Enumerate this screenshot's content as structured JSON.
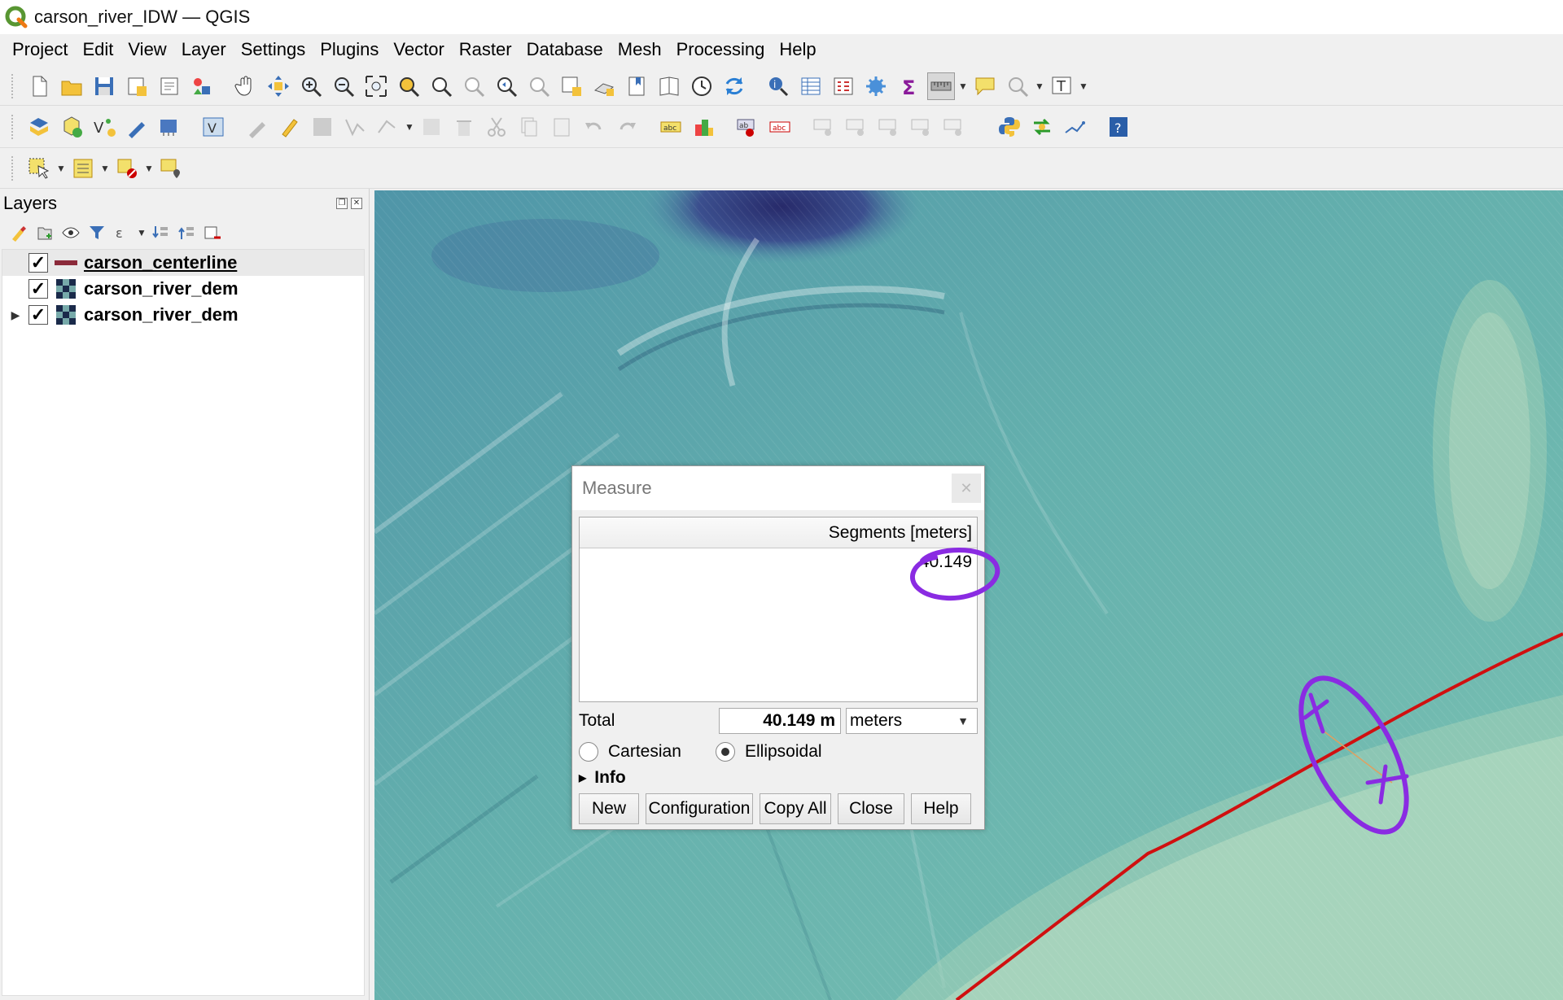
{
  "window": {
    "title": "carson_river_IDW — QGIS"
  },
  "menu": [
    "Project",
    "Edit",
    "View",
    "Layer",
    "Settings",
    "Plugins",
    "Vector",
    "Raster",
    "Database",
    "Mesh",
    "Processing",
    "Help"
  ],
  "layers_panel": {
    "title": "Layers",
    "layers": [
      {
        "name": "carson_centerline",
        "checked": true,
        "type": "line",
        "selected": true,
        "expandable": false
      },
      {
        "name": "carson_river_dem",
        "checked": true,
        "type": "raster",
        "selected": false,
        "expandable": false
      },
      {
        "name": "carson_river_dem",
        "checked": true,
        "type": "raster",
        "selected": false,
        "expandable": true
      }
    ]
  },
  "measure": {
    "title": "Measure",
    "segments_header": "Segments [meters]",
    "segments": [
      "40.149"
    ],
    "total_label": "Total",
    "total_value": "40.149 m",
    "unit": "meters",
    "cartesian_label": "Cartesian",
    "ellipsoidal_label": "Ellipsoidal",
    "selected_mode": "Ellipsoidal",
    "info_label": "Info",
    "buttons": {
      "new": "New",
      "configuration": "Configuration",
      "copy_all": "Copy All",
      "close": "Close",
      "help": "Help"
    }
  },
  "colors": {
    "annotation": "#8a2be2",
    "centerline": "#d01010",
    "terrain": "#5fa8ac"
  }
}
